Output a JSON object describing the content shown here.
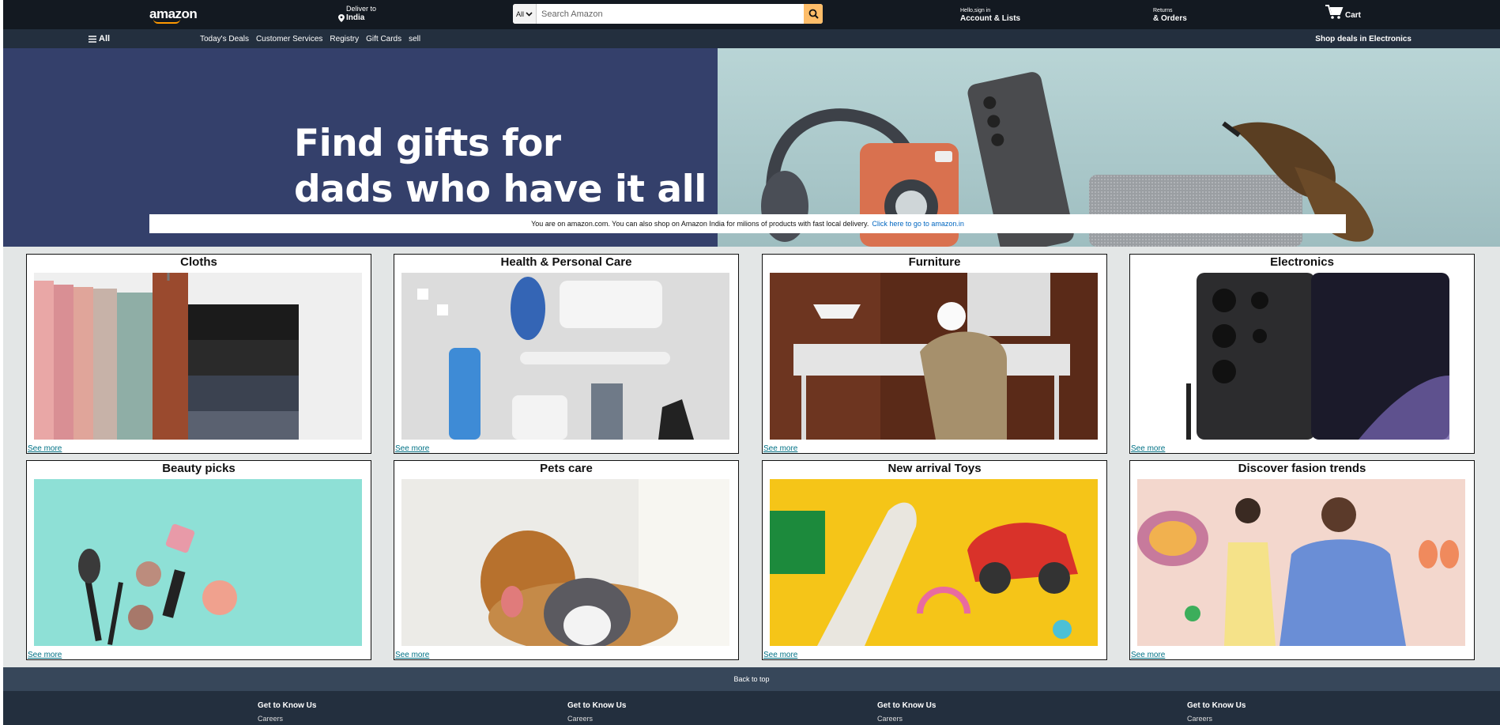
{
  "header": {
    "logo": "amazon",
    "deliver_label": "Deliver to",
    "deliver_location": "India",
    "search": {
      "category": "All",
      "placeholder": "Search Amazon"
    },
    "account_greeting": "Hello,sign in",
    "account_label": "Account & Lists",
    "returns_label": "Returns",
    "orders_label": "& Orders",
    "cart_label": "Cart"
  },
  "nav": {
    "all_label": "All",
    "links": [
      "Today's Deals",
      "Customer Services",
      "Registry",
      "Gift Cards",
      "sell"
    ],
    "right_link": "Shop deals in Electronics"
  },
  "hero": {
    "title_line1": "Find gifts for",
    "title_line2": "dads who have it all",
    "notice_text": "You are on amazon.com. You can also shop on Amazon India for milions of products with fast local delivery.",
    "notice_link": "Click here to go to amazon.in"
  },
  "cards": [
    {
      "title": "Cloths",
      "link": "See more"
    },
    {
      "title": "Health & Personal Care",
      "link": "See more"
    },
    {
      "title": "Furniture",
      "link": "See more"
    },
    {
      "title": "Electronics",
      "link": "See more"
    },
    {
      "title": "Beauty picks",
      "link": "See more"
    },
    {
      "title": "Pets care",
      "link": "See more"
    },
    {
      "title": "New arrival Toys",
      "link": "See more"
    },
    {
      "title": "Discover fasion trends",
      "link": "See more"
    }
  ],
  "footer": {
    "back_to_top": "Back to top",
    "columns": [
      {
        "heading": "Get to Know Us",
        "item": "Careers"
      },
      {
        "heading": "Get to Know Us",
        "item": "Careers"
      },
      {
        "heading": "Get to Know Us",
        "item": "Careers"
      },
      {
        "heading": "Get to Know Us",
        "item": "Careers"
      }
    ]
  },
  "colors": {
    "top_bar": "#131921",
    "nav_bar": "#232f3e",
    "search_button": "#febd69",
    "hero_left": "#34406b",
    "link": "#007185",
    "content_bg": "#e3e6e6"
  }
}
